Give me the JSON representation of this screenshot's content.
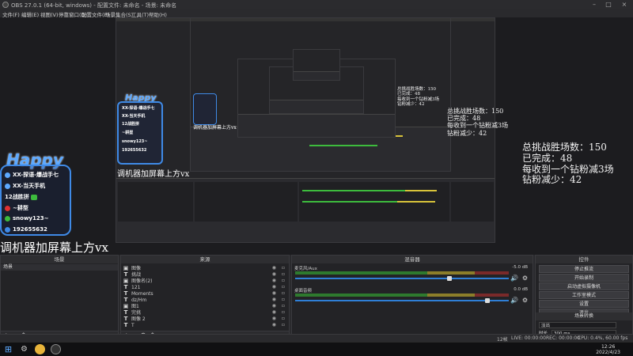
{
  "window": {
    "title": "OBS 27.0.1 (64-bit, windows) - 配置文件: 未命名 - 场景: 未命名"
  },
  "menu": [
    "文件(F)",
    "编辑(E)",
    "视图(V)",
    "停靠窗口(D)",
    "配置文件(P)",
    "场景集合(S)",
    "工具(T)",
    "帮助(H)"
  ],
  "overlay": {
    "happy": "Happy",
    "rows": [
      "XX-探语-爆战手七",
      "XX-当天手机",
      "12战胜拼 ",
      "~耕型",
      "snowy123~",
      "192655632"
    ],
    "bottom_caption": "调机器加屏幕上方vx",
    "stats": [
      "总挑战胜场数：150",
      "已完成：48",
      "每收到一个钻粉减3场",
      "钻粉减少：42"
    ]
  },
  "docks": {
    "scenes": {
      "title": "场景",
      "items": [
        "场景"
      ]
    },
    "sources": {
      "title": "来源",
      "items": [
        {
          "icon": "▣",
          "label": "图像"
        },
        {
          "icon": "T",
          "label": "挑战"
        },
        {
          "icon": "▣",
          "label": "图像名(2)"
        },
        {
          "icon": "T",
          "label": "121"
        },
        {
          "icon": "T",
          "label": "Moments"
        },
        {
          "icon": "T",
          "label": "dz/Hm"
        },
        {
          "icon": "▣",
          "label": "图1"
        },
        {
          "icon": "T",
          "label": "完挑"
        },
        {
          "icon": "T",
          "label": "图像 2"
        },
        {
          "icon": "T",
          "label": "T"
        }
      ]
    },
    "mixer": {
      "title": "混音器",
      "tracks": [
        {
          "name": "麦克风/Aux",
          "db": "-5.0 dB"
        },
        {
          "name": "桌面音频",
          "db": "0.0 dB"
        }
      ],
      "ticks": [
        "-60",
        "-55",
        "-50",
        "-45",
        "-40",
        "-35",
        "-30",
        "-25",
        "-20",
        "-15",
        "-10",
        "-5",
        "0"
      ]
    },
    "controls": {
      "title": "控件",
      "buttons": [
        "停止推流",
        "开始录制",
        "启动虚拟摄像机",
        "工作室模式",
        "设置",
        "退出"
      ],
      "transition_label": "场景转换",
      "transition_value": "淡出",
      "duration_label": "时长",
      "duration_value": "300 ms"
    }
  },
  "status": {
    "live": "LIVE: 00:00:00",
    "rec": "REC: 00:00:00",
    "cpu": "CPU: 0.4%, 60.00 fps",
    "dropped": "12帧"
  },
  "taskbar": {
    "time": "12:26",
    "date": "2022/4/23"
  },
  "colors": {
    "accent": "#3f8ae6",
    "meter_green": "#3dbb3d",
    "meter_yellow": "#d8c33a",
    "meter_red": "#c43a3a"
  }
}
